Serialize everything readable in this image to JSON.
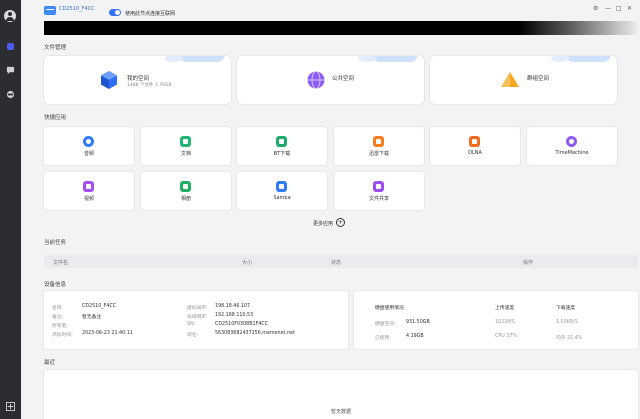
{
  "topbar": {
    "device_name": "CD2510_F4CC",
    "toggle_label": "使用此节点连接互联网",
    "toggle_on": true,
    "window_controls": [
      "⚙",
      "—",
      "□",
      "✕"
    ]
  },
  "sections": {
    "file_mgmt": "文件管理",
    "quick_apps": "快捷应用",
    "current_tasks": "当前任务",
    "device_info": "设备信息",
    "recent": "最近"
  },
  "spaces": [
    {
      "title": "我的空间",
      "subtitle": "1486 个文件  3.76GB",
      "icon": "my-space-cube-icon",
      "color": "#2f6df6"
    },
    {
      "title": "公共空间",
      "subtitle": "",
      "icon": "public-space-globe-icon",
      "color": "#8b5cf6"
    },
    {
      "title": "群组空间",
      "subtitle": "",
      "icon": "group-space-pyramid-icon",
      "color": "#f5a623"
    }
  ],
  "apps": [
    {
      "label": "音频",
      "icon": "music-icon",
      "color": "#2f7cf6"
    },
    {
      "label": "文档",
      "icon": "document-icon",
      "color": "#22b573"
    },
    {
      "label": "BT下载",
      "icon": "bt-download-icon",
      "color": "#1fab6c"
    },
    {
      "label": "迅雷下载",
      "icon": "thunder-download-icon",
      "color": "#f57c1f"
    },
    {
      "label": "DLNA",
      "icon": "dlna-icon",
      "color": "#f36b1c"
    },
    {
      "label": "TimeMachine",
      "icon": "time-machine-icon",
      "color": "#8e5cf0"
    },
    {
      "label": "视频",
      "icon": "video-icon",
      "color": "#a44ff5"
    },
    {
      "label": "相册",
      "icon": "photo-album-icon",
      "color": "#1fb062"
    },
    {
      "label": "Samba",
      "icon": "samba-icon",
      "color": "#2f7cf6"
    },
    {
      "label": "文件共享",
      "icon": "file-share-icon",
      "color": "#9d4df2"
    }
  ],
  "more": {
    "label": "更多应用",
    "icon": "plus-circle-icon"
  },
  "task_table": {
    "columns": [
      "文件名",
      "大小",
      "状态",
      "操作"
    ]
  },
  "device": {
    "left": [
      {
        "k": "名称:",
        "v": "CD2510_F4CC"
      },
      {
        "k": "备注:",
        "v": "暂无备注"
      },
      {
        "k": "所有者:",
        "v": ""
      },
      {
        "k": "添加时间:",
        "v": "2023-06-23 21:40:11"
      }
    ],
    "mid": [
      {
        "k": "虚拟局IP:",
        "v": "198.18.46.107"
      },
      {
        "k": "局域网IP:",
        "v": "192.168.110.53"
      },
      {
        "k": "SN:",
        "v": "CD2510F0308B1F4CC"
      },
      {
        "k": "域名:",
        "v": "563083682437256.memenet.net"
      }
    ]
  },
  "usage": {
    "headers": [
      "硬盘使用情况",
      "上传速度",
      "下载速度"
    ],
    "rows": [
      {
        "k1": "硬盘空间:",
        "v1": "931.50GB",
        "v2": "10238/S",
        "v3": "1.03KB/S"
      },
      {
        "k1": "已使用:",
        "v1": "4.19GB",
        "v2": "CPU 37%",
        "v3": "内存 21.4%"
      }
    ]
  },
  "recent": {
    "empty": "暂无数据"
  }
}
